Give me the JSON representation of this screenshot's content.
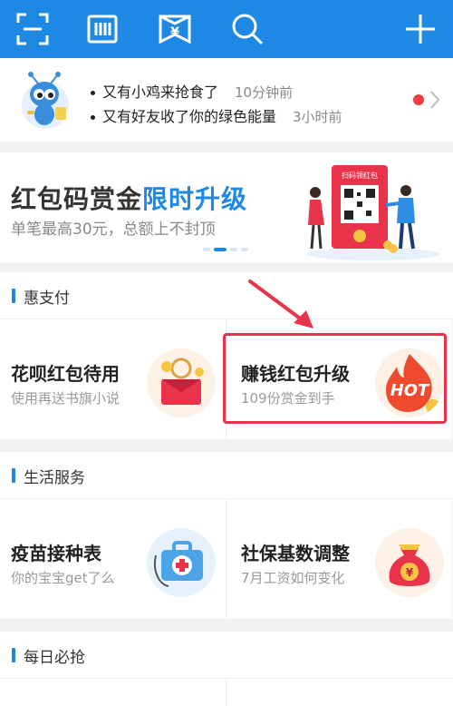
{
  "topbar": {
    "buttons": [
      {
        "name": "scan-button",
        "icon": "scan-icon"
      },
      {
        "name": "pay-code-button",
        "icon": "barcode-icon"
      },
      {
        "name": "collect-money-button",
        "icon": "yuan-envelope-icon",
        "glyph": "¥"
      },
      {
        "name": "search-button",
        "icon": "search-icon"
      },
      {
        "name": "add-button",
        "icon": "plus-icon"
      }
    ],
    "color": "#1e88e5"
  },
  "notice": {
    "lines": [
      {
        "text": "又有小鸡来抢食了",
        "time": "10分钟前"
      },
      {
        "text": "又有好友收了你的绿色能量",
        "time": "3小时前"
      }
    ],
    "badge_color": "#f23c3c"
  },
  "banner": {
    "title_main": "红包码赏金",
    "title_highlight": "限时升级",
    "subtitle": "单笔最高30元，总额上不封顶",
    "sign_text": "扫码领红包",
    "pages": 3,
    "active_page": 1
  },
  "sections": [
    {
      "title": "惠支付",
      "cards": [
        {
          "title": "花呗红包待用",
          "subtitle": "使用再送书旗小说",
          "icon": "red-envelope-gift-icon"
        },
        {
          "title": "赚钱红包升级",
          "subtitle": "109份赏金到手",
          "icon": "hot-flame-icon",
          "icon_text": "HOT"
        }
      ]
    },
    {
      "title": "生活服务",
      "cards": [
        {
          "title": "疫苗接种表",
          "subtitle": "你的宝宝get了么",
          "icon": "medical-kit-icon"
        },
        {
          "title": "社保基数调整",
          "subtitle": "7月工资如何变化",
          "icon": "money-bag-icon",
          "icon_text": "¥"
        }
      ]
    },
    {
      "title": "每日必抢",
      "cards": []
    }
  ],
  "annotation": {
    "color": "#e8334a"
  }
}
